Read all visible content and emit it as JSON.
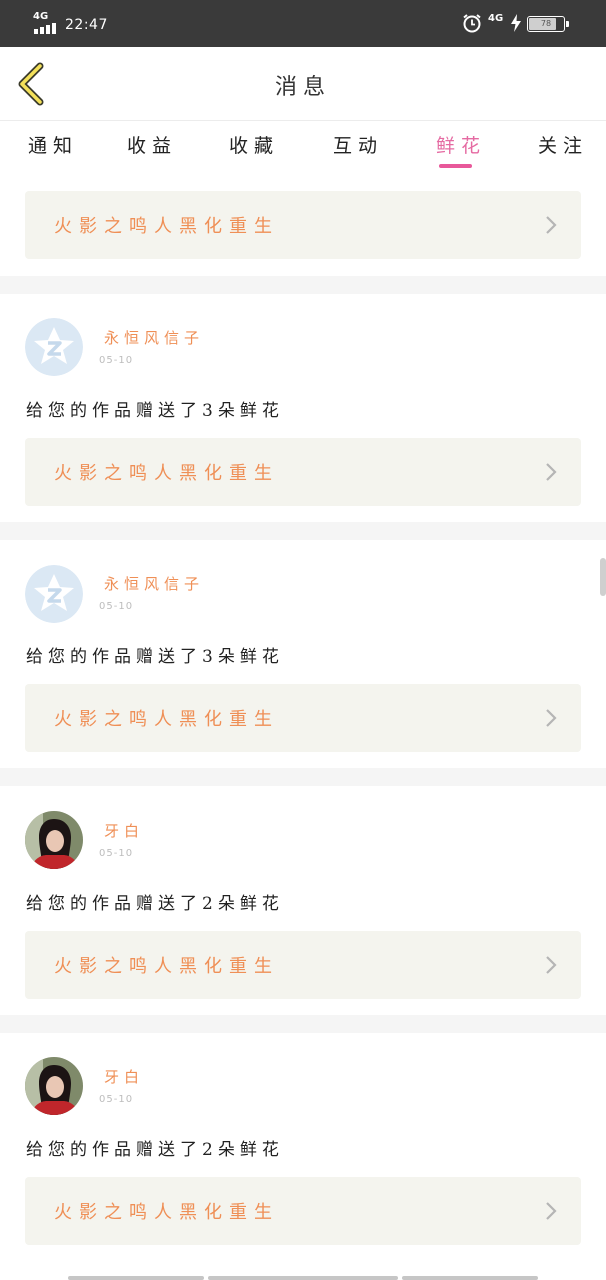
{
  "status_bar": {
    "network": "4G",
    "time": "22:47",
    "network_right": "4G",
    "battery": "78"
  },
  "header": {
    "title": "消息"
  },
  "tabs": [
    {
      "label": "通知"
    },
    {
      "label": "收益"
    },
    {
      "label": "收藏"
    },
    {
      "label": "互动"
    },
    {
      "label": "鲜花",
      "active": true
    },
    {
      "label": "关注"
    }
  ],
  "colors": {
    "accent_pink": "#e8589a",
    "orange_text": "#ef8f56",
    "card_bg": "#f4f4ee"
  },
  "icons": {
    "back": "back-chevron-icon",
    "card_arrow": "chevron-right-icon"
  },
  "top_card": {
    "work_title": "火影之鸣人黑化重生"
  },
  "messages": [
    {
      "user": "永恒风信子",
      "avatar": "qq-default-avatar",
      "date": "05-10",
      "text": "给您的作品赠送了3朵鲜花",
      "work_title": "火影之鸣人黑化重生"
    },
    {
      "user": "永恒风信子",
      "avatar": "qq-default-avatar",
      "date": "05-10",
      "text": "给您的作品赠送了3朵鲜花",
      "work_title": "火影之鸣人黑化重生"
    },
    {
      "user": "牙白",
      "avatar": "photo-avatar",
      "date": "05-10",
      "text": "给您的作品赠送了2朵鲜花",
      "work_title": "火影之鸣人黑化重生"
    },
    {
      "user": "牙白",
      "avatar": "photo-avatar",
      "date": "05-10",
      "text": "给您的作品赠送了2朵鲜花",
      "work_title": "火影之鸣人黑化重生"
    }
  ]
}
